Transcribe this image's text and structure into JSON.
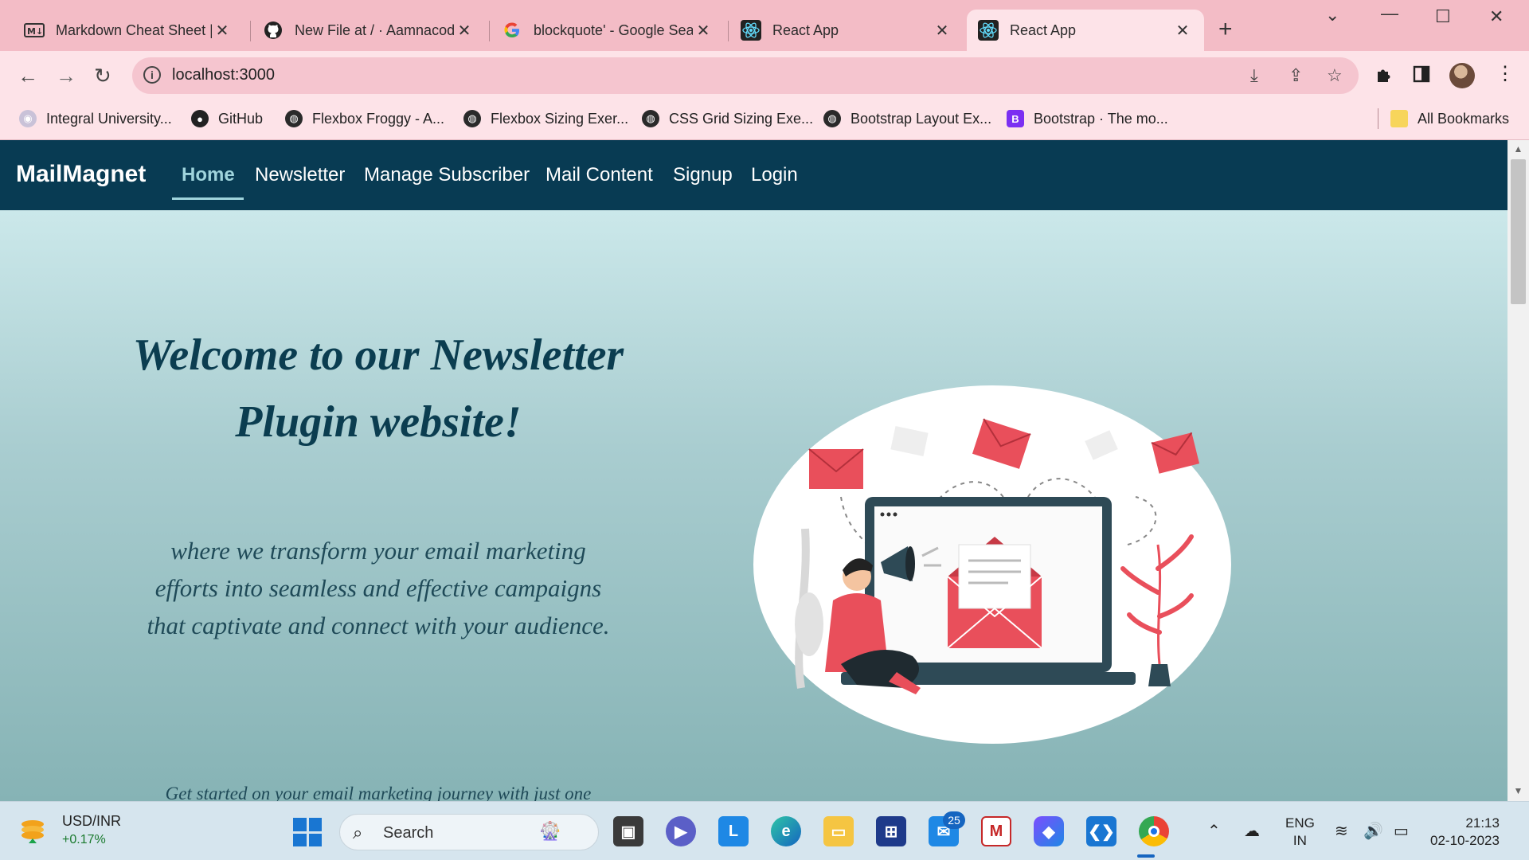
{
  "browser": {
    "tabs": [
      {
        "title": "Markdown Cheat Sheet |",
        "favicon": "markdown-icon"
      },
      {
        "title": "New File at / · Aamnacod",
        "favicon": "github-icon"
      },
      {
        "title": "blockquote' - Google Sea",
        "favicon": "google-icon"
      },
      {
        "title": "React App",
        "favicon": "react-icon"
      },
      {
        "title": "React App",
        "favicon": "react-icon",
        "active": true
      }
    ],
    "close_glyph": "✕",
    "address": "localhost:3000",
    "bookmarks": [
      {
        "label": "Integral University...",
        "icon": "university-icon"
      },
      {
        "label": "GitHub",
        "icon": "github-icon"
      },
      {
        "label": "Flexbox Froggy - A...",
        "icon": "globe-icon"
      },
      {
        "label": "Flexbox Sizing Exer...",
        "icon": "globe-icon"
      },
      {
        "label": "CSS Grid Sizing Exe...",
        "icon": "globe-icon"
      },
      {
        "label": "Bootstrap Layout Ex...",
        "icon": "globe-icon"
      },
      {
        "label": "Bootstrap · The mo...",
        "icon": "bootstrap-icon"
      }
    ],
    "all_bookmarks": "All Bookmarks"
  },
  "app": {
    "brand": "MailMagnet",
    "nav": [
      "Home",
      "Newsletter",
      "Manage Subscriber",
      "Mail Content",
      "Signup",
      "Login"
    ],
    "active_nav": "Home",
    "hero": {
      "title": "Welcome to our Newsletter Plugin website!",
      "subtitle": "where we transform your email marketing efforts into seamless and effective campaigns that captivate and connect with your audience.",
      "cta_text": "Get started on your email marketing journey with just one"
    },
    "colors": {
      "navbar": "#083b53",
      "accent": "#9fd4dc",
      "heading": "#0b3d50",
      "illustration_red": "#e94f5b"
    }
  },
  "taskbar": {
    "ticker_symbol": "USD/INR",
    "ticker_change": "+0.17%",
    "search_placeholder": "Search",
    "mail_badge": "25",
    "lang_line1": "ENG",
    "lang_line2": "IN",
    "time": "21:13",
    "date": "02-10-2023"
  }
}
